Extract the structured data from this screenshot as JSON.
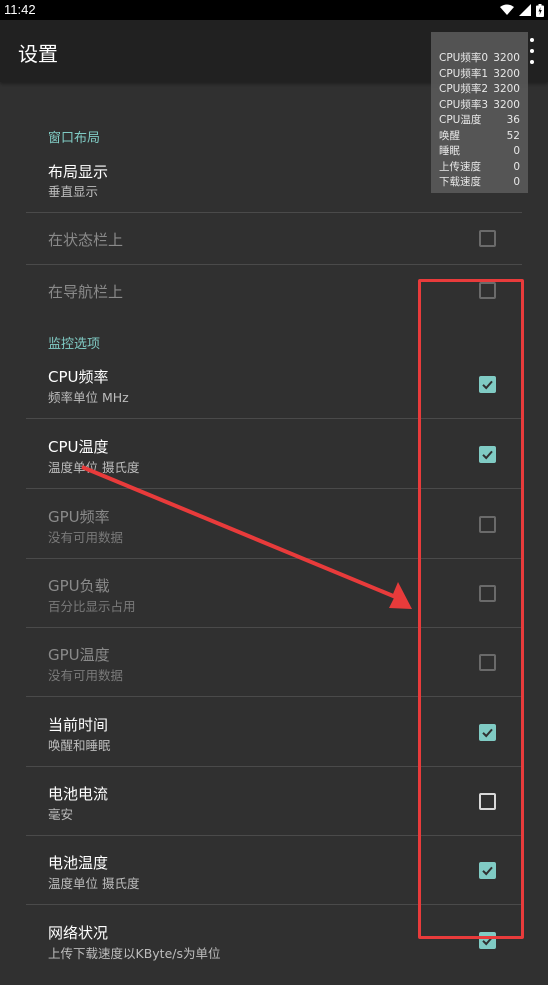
{
  "status_bar": {
    "time": "11:42"
  },
  "app_bar": {
    "title": "设置"
  },
  "overlay": {
    "rows": [
      {
        "label": "CPU频率0",
        "value": "3200"
      },
      {
        "label": "CPU频率1",
        "value": "3200"
      },
      {
        "label": "CPU频率2",
        "value": "3200"
      },
      {
        "label": "CPU频率3",
        "value": "3200"
      },
      {
        "label": "CPU温度",
        "value": "36"
      },
      {
        "label": "唤醒",
        "value": "52"
      },
      {
        "label": "睡眠",
        "value": "0"
      },
      {
        "label": "上传速度",
        "value": "0"
      },
      {
        "label": "下载速度",
        "value": "0"
      }
    ]
  },
  "categories": {
    "window_layout": "窗口布局",
    "monitor_options": "监控选项"
  },
  "prefs": {
    "layout_display": {
      "title": "布局显示",
      "summary": "垂直显示"
    },
    "on_status_bar": {
      "title": "在状态栏上",
      "checked": false,
      "enabled": false
    },
    "on_nav_bar": {
      "title": "在导航栏上",
      "checked": false,
      "enabled": false
    },
    "cpu_freq": {
      "title": "CPU频率",
      "summary": "频率单位 MHz",
      "checked": true,
      "enabled": true
    },
    "cpu_temp": {
      "title": "CPU温度",
      "summary": "温度单位 摄氏度",
      "checked": true,
      "enabled": true
    },
    "gpu_freq": {
      "title": "GPU频率",
      "summary": "没有可用数据",
      "checked": false,
      "enabled": false
    },
    "gpu_load": {
      "title": "GPU负载",
      "summary": "百分比显示占用",
      "checked": false,
      "enabled": false
    },
    "gpu_temp": {
      "title": "GPU温度",
      "summary": "没有可用数据",
      "checked": false,
      "enabled": false
    },
    "current_time": {
      "title": "当前时间",
      "summary": "唤醒和睡眠",
      "checked": true,
      "enabled": true
    },
    "battery_current": {
      "title": "电池电流",
      "summary": "毫安",
      "checked": false,
      "enabled": true
    },
    "battery_temp": {
      "title": "电池温度",
      "summary": "温度单位 摄氏度",
      "checked": true,
      "enabled": true
    },
    "network_status": {
      "title": "网络状况",
      "summary": "上传下载速度以KByte/s为单位",
      "checked": true,
      "enabled": true
    }
  },
  "colors": {
    "accent": "#80cbc4",
    "annotation": "#e83b3b",
    "background": "#303030",
    "app_bar": "#212121"
  }
}
